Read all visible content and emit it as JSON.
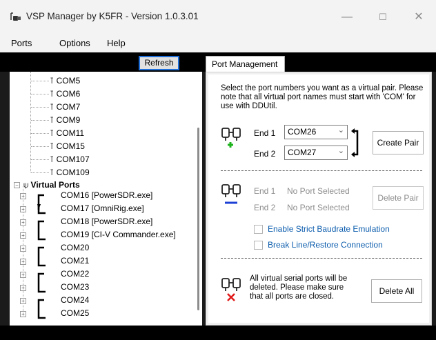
{
  "window": {
    "title": "VSP Manager by K5FR - Version 1.0.3.01",
    "icon": "serial-connector-icon",
    "controls": [
      "minimize-icon",
      "maximize-icon",
      "close-icon"
    ]
  },
  "menu": [
    "Ports",
    "Options",
    "Help"
  ],
  "toolbar": {
    "refresh_label": "Refresh"
  },
  "tabs": [
    "Port Management"
  ],
  "tree": {
    "physical_ports": [
      "COM5",
      "COM6",
      "COM7",
      "COM9",
      "COM11",
      "COM15",
      "COM107",
      "COM109"
    ],
    "virtual_ports_label": "Virtual Ports",
    "virtual_ports": [
      "COM16 [PowerSDR.exe]",
      "COM17 [OmniRig.exe]",
      "COM18 [PowerSDR.exe]",
      "COM19 [CI-V Commander.exe]",
      "COM20",
      "COM21",
      "COM22",
      "COM23",
      "COM24",
      "COM25"
    ]
  },
  "port_management": {
    "description": "Select the port numbers you want as a virtual pair. Please note that all virtual port names must start with 'COM' for use with DDUtil.",
    "create": {
      "end1_label": "End 1",
      "end1_value": "COM26",
      "end2_label": "End 2",
      "end2_value": "COM27",
      "button": "Create Pair",
      "icon": "add-pair-icon"
    },
    "delete": {
      "end1_label": "End 1",
      "end1_value": "No Port Selected",
      "end2_label": "End 2",
      "end2_value": "No Port Selected",
      "button": "Delete Pair",
      "icon": "remove-pair-icon"
    },
    "options": {
      "strict_baud": "Enable Strict Baudrate Emulation",
      "break_line": "Break Line/Restore Connection"
    },
    "delete_all": {
      "text": "All virtual serial ports will be deleted. Please make sure that all ports are closed.",
      "button": "Delete All",
      "icon": "delete-all-icon"
    }
  }
}
